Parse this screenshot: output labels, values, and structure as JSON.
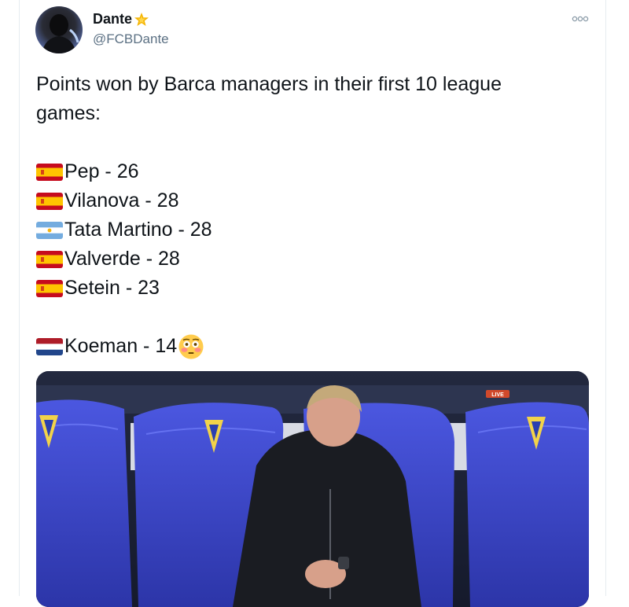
{
  "tweet": {
    "author": {
      "display_name": "Dante",
      "handle": "@FCBDante",
      "badge_icon": "star-icon",
      "avatar": "avatar"
    },
    "menu_icon": "more-icon",
    "text": {
      "intro_line1": "Points won by Barca managers in their first 10 league",
      "intro_line2": "games:",
      "managers": [
        {
          "flag": "spain-flag-icon",
          "label": "Pep - 26"
        },
        {
          "flag": "spain-flag-icon",
          "label": "Vilanova - 28"
        },
        {
          "flag": "argentina-flag-icon",
          "label": "Tata Martino - 28"
        },
        {
          "flag": "spain-flag-icon",
          "label": "Valverde - 28"
        },
        {
          "flag": "spain-flag-icon",
          "label": "Setein - 23"
        }
      ],
      "last": {
        "flag": "netherlands-flag-icon",
        "label": "Koeman - 14",
        "emoji": "flushed-face-icon"
      }
    },
    "media": {
      "live_badge": "LIVE"
    }
  },
  "colors": {
    "text": "#0f1419",
    "secondary": "#5b7083",
    "star": "#f5b400",
    "seat_blue": "#3b45c8"
  }
}
